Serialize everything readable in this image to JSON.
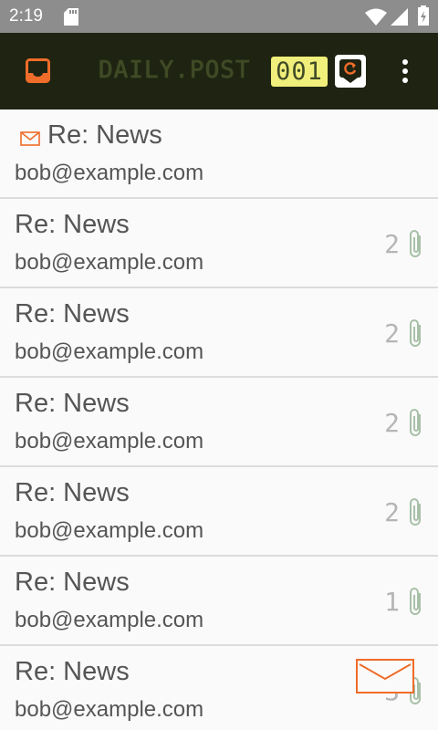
{
  "status_bar": {
    "time": "2:19",
    "icons": [
      "sd-card-icon",
      "wifi-icon",
      "signal-icon",
      "battery-icon"
    ]
  },
  "toolbar": {
    "title": "DAILY.POST",
    "counter": "001",
    "icons": [
      "inbox-icon",
      "refresh-icon",
      "overflow-menu-icon"
    ],
    "colors": {
      "background": "#1e2411",
      "accent": "#ef6c2a",
      "counter_bg": "#f1ef7b"
    }
  },
  "messages": [
    {
      "subject": "Re: News",
      "sender": "bob@example.com",
      "unread": true,
      "count": "",
      "attachment": false
    },
    {
      "subject": "Re: News",
      "sender": "bob@example.com",
      "unread": false,
      "count": "2",
      "attachment": true
    },
    {
      "subject": "Re: News",
      "sender": "bob@example.com",
      "unread": false,
      "count": "2",
      "attachment": true
    },
    {
      "subject": "Re: News",
      "sender": "bob@example.com",
      "unread": false,
      "count": "2",
      "attachment": true
    },
    {
      "subject": "Re: News",
      "sender": "bob@example.com",
      "unread": false,
      "count": "2",
      "attachment": true
    },
    {
      "subject": "Re: News",
      "sender": "bob@example.com",
      "unread": false,
      "count": "1",
      "attachment": true
    },
    {
      "subject": "Re: News",
      "sender": "bob@example.com",
      "unread": false,
      "count": "3",
      "attachment": true
    }
  ],
  "compose": {
    "icon": "envelope-icon"
  }
}
